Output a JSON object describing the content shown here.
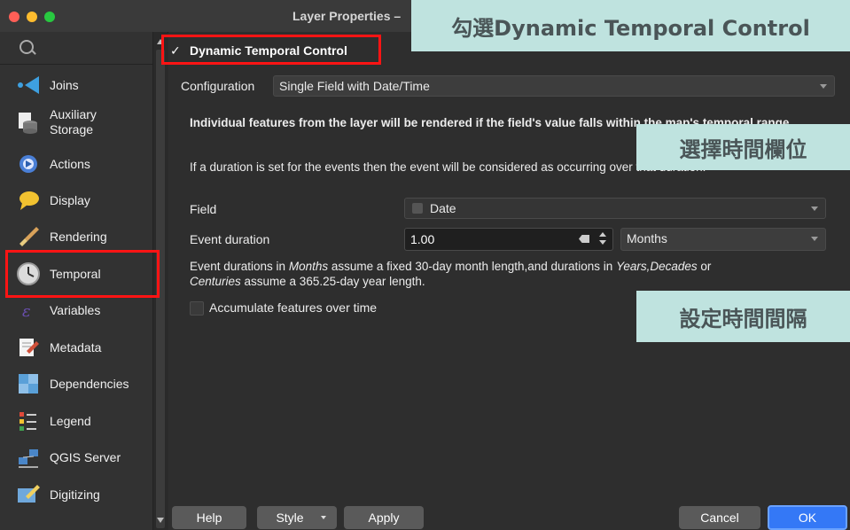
{
  "window": {
    "title": "Layer Properties –"
  },
  "sidebar": {
    "items": [
      {
        "label": "Joins",
        "icon": "joins-icon"
      },
      {
        "label": "Auxiliary\nStorage",
        "icon": "auxiliary-storage-icon"
      },
      {
        "label": "Actions",
        "icon": "actions-icon"
      },
      {
        "label": "Display",
        "icon": "display-icon"
      },
      {
        "label": "Rendering",
        "icon": "rendering-icon"
      },
      {
        "label": "Temporal",
        "icon": "clock-icon"
      },
      {
        "label": "Variables",
        "icon": "variables-icon"
      },
      {
        "label": "Metadata",
        "icon": "metadata-icon"
      },
      {
        "label": "Dependencies",
        "icon": "dependencies-icon"
      },
      {
        "label": "Legend",
        "icon": "legend-icon"
      },
      {
        "label": "QGIS Server",
        "icon": "qgis-server-icon"
      },
      {
        "label": "Digitizing",
        "icon": "digitizing-icon"
      }
    ]
  },
  "temporal": {
    "dynamic_control_label": "Dynamic Temporal Control",
    "dynamic_control_checked": true,
    "configuration_label": "Configuration",
    "configuration_value": "Single Field with Date/Time",
    "description_bold": "Individual features from the layer will be rendered if the field's value falls within the map's temporal range.",
    "description_duration": "If a duration is set for the events then the event will be considered as occurring over that duration.",
    "field_label": "Field",
    "field_value": "Date",
    "event_duration_label": "Event duration",
    "event_duration_value": "1.00",
    "event_duration_unit": "Months",
    "duration_note_1": "Event durations in ",
    "duration_note_months": "Months",
    "duration_note_2": " assume a fixed 30-day month length,and durations in ",
    "duration_note_years": "Years,Decades",
    "duration_note_3": " or",
    "duration_note_centuries": "Centuries",
    "duration_note_4": " assume a 365.25-day year length.",
    "accumulate_label": "Accumulate features over time"
  },
  "buttons": {
    "help": "Help",
    "style": "Style",
    "apply": "Apply",
    "cancel": "Cancel",
    "ok": "OK"
  },
  "annotations": {
    "top": "勾選Dynamic Temporal Control",
    "field": "選擇時間欄位",
    "interval": "設定時間間隔"
  }
}
